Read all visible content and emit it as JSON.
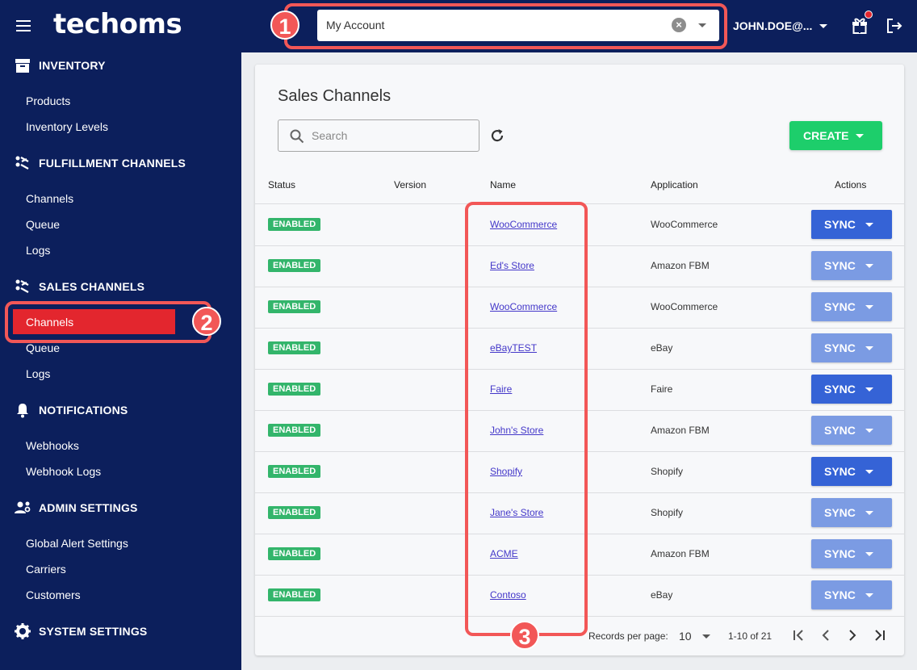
{
  "header": {
    "logo": "techoms",
    "account_value": "My Account",
    "user_email": "JOHN.DOE@..."
  },
  "callouts": [
    "1",
    "2",
    "3"
  ],
  "sidebar": {
    "sections": [
      {
        "title": "INVENTORY",
        "icon": "archive-icon",
        "items": [
          "Products",
          "Inventory Levels"
        ]
      },
      {
        "title": "FULFILLMENT CHANNELS",
        "icon": "channels-icon",
        "items": [
          "Channels",
          "Queue",
          "Logs"
        ]
      },
      {
        "title": "SALES CHANNELS",
        "icon": "channels-icon",
        "items": [
          "Channels",
          "Queue",
          "Logs"
        ]
      },
      {
        "title": "NOTIFICATIONS",
        "icon": "bell-icon",
        "items": [
          "Webhooks",
          "Webhook Logs"
        ]
      },
      {
        "title": "ADMIN SETTINGS",
        "icon": "admin-users-icon",
        "items": [
          "Global Alert Settings",
          "Carriers",
          "Customers"
        ]
      },
      {
        "title": "SYSTEM SETTINGS",
        "icon": "gear-icon",
        "items": []
      }
    ]
  },
  "main": {
    "title": "Sales Channels",
    "search_placeholder": "Search",
    "create_label": "CREATE",
    "columns": [
      "Status",
      "Version",
      "Name",
      "Application",
      "Actions"
    ],
    "rows": [
      {
        "status": "ENABLED",
        "version": "",
        "name": "WooCommerce",
        "application": "WooCommerce",
        "action": "SYNC",
        "sync_active": true
      },
      {
        "status": "ENABLED",
        "version": "",
        "name": "Ed's Store",
        "application": "Amazon FBM",
        "action": "SYNC",
        "sync_active": false
      },
      {
        "status": "ENABLED",
        "version": "",
        "name": "WooCommerce",
        "application": "WooCommerce",
        "action": "SYNC",
        "sync_active": false
      },
      {
        "status": "ENABLED",
        "version": "",
        "name": "eBayTEST",
        "application": "eBay",
        "action": "SYNC",
        "sync_active": false
      },
      {
        "status": "ENABLED",
        "version": "",
        "name": "Faire",
        "application": "Faire",
        "action": "SYNC",
        "sync_active": true
      },
      {
        "status": "ENABLED",
        "version": "",
        "name": "John's Store",
        "application": "Amazon FBM",
        "action": "SYNC",
        "sync_active": false
      },
      {
        "status": "ENABLED",
        "version": "",
        "name": "Shopify",
        "application": "Shopify",
        "action": "SYNC",
        "sync_active": true
      },
      {
        "status": "ENABLED",
        "version": "",
        "name": "Jane's Store",
        "application": "Shopify",
        "action": "SYNC",
        "sync_active": false
      },
      {
        "status": "ENABLED",
        "version": "",
        "name": "ACME",
        "application": "Amazon FBM",
        "action": "SYNC",
        "sync_active": false
      },
      {
        "status": "ENABLED",
        "version": "",
        "name": "Contoso",
        "application": "eBay",
        "action": "SYNC",
        "sync_active": false
      }
    ],
    "pagination": {
      "records_label": "Records per page:",
      "per_page": "10",
      "range": "1-10 of 21"
    }
  },
  "colors": {
    "nav_bg": "#0c1f5c",
    "active_red": "#e3262e",
    "callout": "#f25757",
    "create_green": "#1dce6b",
    "sync_active": "#3563d6",
    "sync_muted": "#7b9be3",
    "badge_green": "#33b56b",
    "link": "#4337c9"
  }
}
